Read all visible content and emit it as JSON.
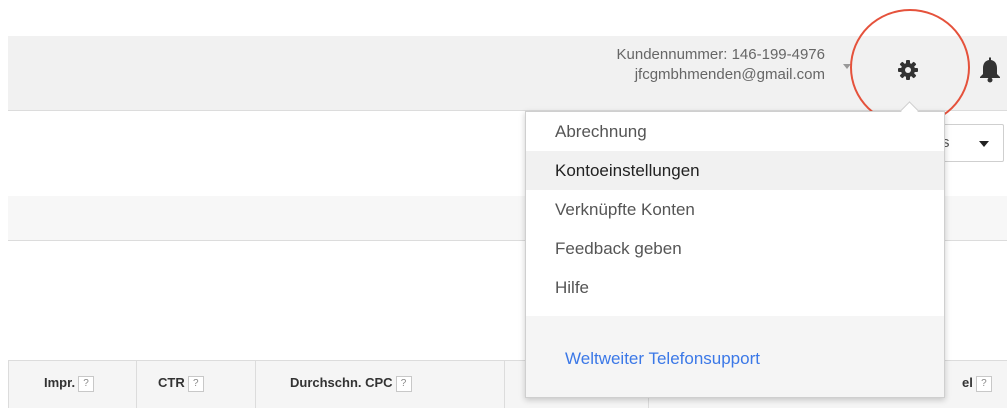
{
  "header": {
    "customer_number": "Kundennummer: 146-199-4976",
    "email": "jfcgmbhmenden@gmail.com"
  },
  "icons": {
    "settings": "gear-icon",
    "notifications": "bell-icon",
    "account_dropdown": "caret-down-icon"
  },
  "settings_menu": {
    "items": [
      {
        "label": "Abrechnung",
        "active": false
      },
      {
        "label": "Kontoeinstellungen",
        "active": true
      },
      {
        "label": "Verknüpfte Konten",
        "active": false
      },
      {
        "label": "Feedback geben",
        "active": false
      },
      {
        "label": "Hilfe",
        "active": false
      }
    ],
    "footer_link": "Weltweiter Telefonsupport"
  },
  "right_dropdown": {
    "visible_text": "s"
  },
  "table": {
    "help_marker": "?",
    "columns": [
      {
        "label": "Impr."
      },
      {
        "label": "CTR"
      },
      {
        "label": "Durchschn. CPC"
      },
      {
        "label": "el"
      }
    ]
  },
  "colors": {
    "highlight_circle": "#e5523c",
    "link": "#3b78e7",
    "topbar": "#f1f1f1",
    "menu_active": "#f1f1f1"
  }
}
